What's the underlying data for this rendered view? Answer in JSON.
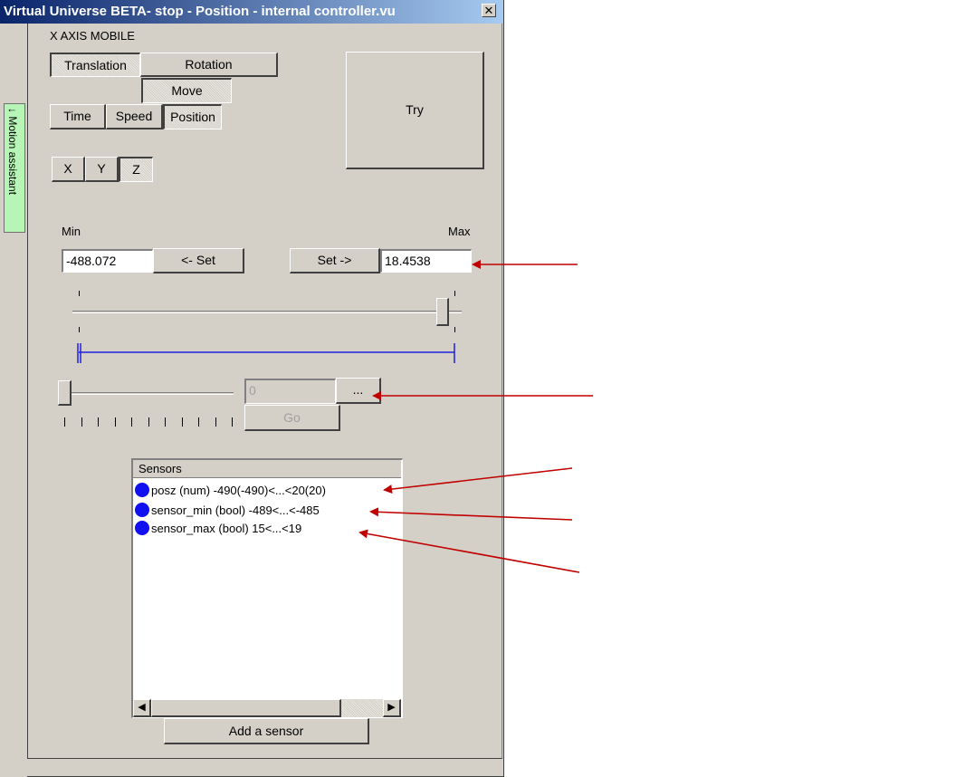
{
  "window": {
    "title": "Virtual Universe BETA- stop - Position - internal controller.vu",
    "close_label": "✕"
  },
  "side_tab": {
    "label": "↓ Motion assistant"
  },
  "axis": {
    "label": "X AXIS MOBILE"
  },
  "motion_type": {
    "translation": "Translation",
    "rotation": "Rotation",
    "move": "Move",
    "selected": "Translation"
  },
  "mode": {
    "time": "Time",
    "speed": "Speed",
    "position": "Position",
    "selected": "Position"
  },
  "axes": {
    "x": "X",
    "y": "Y",
    "z": "Z",
    "selected": "Z"
  },
  "try_button": "Try",
  "limits": {
    "min_label": "Min",
    "max_label": "Max",
    "min_value": "-488.072",
    "max_value": "18.4538",
    "set_min_label": "<- Set",
    "set_max_label": "Set ->"
  },
  "range_slider": {
    "fraction": 0.98
  },
  "target": {
    "value": "0",
    "browse_label": "...",
    "go_label": "Go",
    "slider_fraction": 0.0,
    "tick_count": 11
  },
  "sensors": {
    "header": "Sensors",
    "items": [
      {
        "label": "posz (num) -490(-490)<...<20(20)"
      },
      {
        "label": "sensor_min (bool) -489<...<-485"
      },
      {
        "label": "sensor_max (bool) 15<...<19"
      }
    ],
    "add_label": "Add a sensor"
  },
  "colors": {
    "arrow": "#c00000",
    "sensor_dot": "#1010f0",
    "range_line": "#2020e0"
  }
}
